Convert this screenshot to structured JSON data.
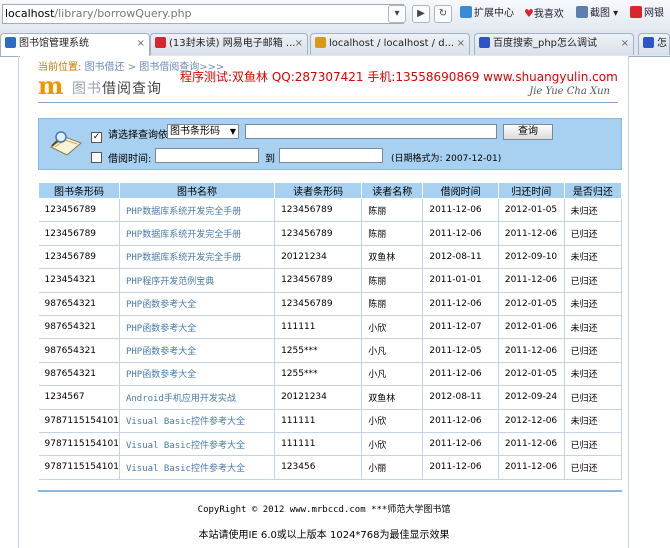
{
  "browser": {
    "url_host": "localhost",
    "url_path": "/library/borrowQuery.php",
    "toolbar": [
      "扩展中心",
      "我喜欢",
      "截图",
      "网银"
    ],
    "tabs": [
      {
        "label": "图书馆管理系统",
        "color": "#2d6cc4"
      },
      {
        "label": "(13封未读) 网易电子邮箱 ...",
        "color": "#d8262f"
      },
      {
        "label": "localhost / localhost / d...",
        "color": "#d89a1a"
      },
      {
        "label": "百度搜索_php怎么调试",
        "color": "#2d55c8"
      },
      {
        "label": "怎",
        "color": "#2d55c8"
      }
    ]
  },
  "page": {
    "crumb_label": "当前位置:",
    "crumb_path": "图书借还 > 图书借阅查询>>>",
    "slogan": "程序测试:双鱼林 QQ:287307421 手机:13558690869 www.shuangyulin.com",
    "logo_m": "m",
    "logo_title_a": "图书",
    "logo_title_b": "借阅查询",
    "logo_sub": "Jie Yue Cha Xun"
  },
  "query": {
    "check1": "✓",
    "label1": "请选择查询依据:",
    "select_value": "图书条形码",
    "query_button": "查询",
    "label2": "借阅时间:  从",
    "to": "到",
    "date_hint": "(日期格式为: 2007-12-01)"
  },
  "table": {
    "headers": [
      "图书条形码",
      "图书名称",
      "读者条形码",
      "读者名称",
      "借阅时间",
      "归还时间",
      "是否归还"
    ],
    "rows": [
      [
        "123456789",
        "PHP数据库系统开发完全手册",
        "123456789",
        "陈丽",
        "2011-12-06",
        "2012-01-05",
        "未归还"
      ],
      [
        "123456789",
        "PHP数据库系统开发完全手册",
        "123456789",
        "陈丽",
        "2011-12-06",
        "2011-12-06",
        "已归还"
      ],
      [
        "123456789",
        "PHP数据库系统开发完全手册",
        "20121234",
        "双鱼林",
        "2012-08-11",
        "2012-09-10",
        "未归还"
      ],
      [
        "123454321",
        "PHP程序开发范例宝典",
        "123456789",
        "陈丽",
        "2011-01-01",
        "2011-12-06",
        "已归还"
      ],
      [
        "987654321",
        "PHP函数参考大全",
        "123456789",
        "陈丽",
        "2011-12-06",
        "2012-01-05",
        "未归还"
      ],
      [
        "987654321",
        "PHP函数参考大全",
        "111111",
        "小欣",
        "2011-12-07",
        "2012-01-06",
        "未归还"
      ],
      [
        "987654321",
        "PHP函数参考大全",
        "1255***",
        "小凡",
        "2011-12-05",
        "2011-12-06",
        "已归还"
      ],
      [
        "987654321",
        "PHP函数参考大全",
        "1255***",
        "小凡",
        "2011-12-06",
        "2012-01-05",
        "未归还"
      ],
      [
        "1234567",
        "Android手机应用开发实战",
        "20121234",
        "双鱼林",
        "2012-08-11",
        "2012-09-24",
        "已归还"
      ],
      [
        "9787115154101",
        "Visual Basic控件参考大全",
        "111111",
        "小欣",
        "2011-12-06",
        "2012-12-06",
        "未归还"
      ],
      [
        "9787115154101",
        "Visual Basic控件参考大全",
        "111111",
        "小欣",
        "2011-12-06",
        "2011-12-06",
        "已归还"
      ],
      [
        "9787115154101",
        "Visual Basic控件参考大全",
        "123456",
        "小丽",
        "2011-12-06",
        "2011-12-06",
        "已归还"
      ]
    ]
  },
  "footer": {
    "copyright": "CopyRight © 2012 www.mrbccd.com  ***师范大学图书馆",
    "hint": "本站请使用IE 6.0或以上版本 1024*768为最佳显示效果"
  }
}
